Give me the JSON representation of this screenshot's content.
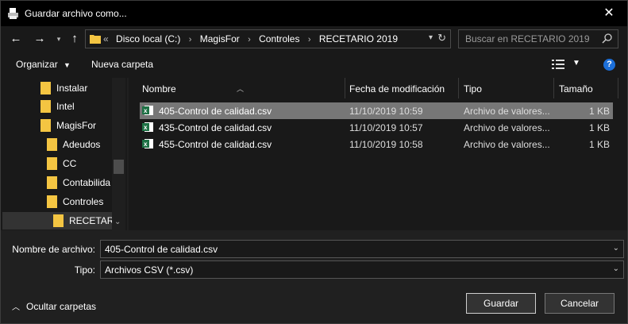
{
  "window": {
    "title": "Guardar archivo como...",
    "close_glyph": "✕"
  },
  "address_bar": {
    "more_glyph": "«",
    "crumbs": [
      "Disco local (C:)",
      "MagisFor",
      "Controles",
      "RECETARIO 2019"
    ]
  },
  "search": {
    "placeholder": "Buscar en RECETARIO 2019"
  },
  "toolbar": {
    "organize_label": "Organizar",
    "new_folder_label": "Nueva carpeta",
    "help_label": "?"
  },
  "tree": {
    "items": [
      {
        "label": "Instalar"
      },
      {
        "label": "Intel"
      },
      {
        "label": "MagisFor"
      },
      {
        "label": "Adeudos"
      },
      {
        "label": "CC"
      },
      {
        "label": "Contabilida"
      },
      {
        "label": "Controles"
      },
      {
        "label": "RECETARIO"
      }
    ]
  },
  "columns": {
    "name": "Nombre",
    "modified": "Fecha de modificación",
    "type": "Tipo",
    "size": "Tamaño"
  },
  "files": [
    {
      "name": "405-Control de calidad.csv",
      "modified": "11/10/2019 10:59",
      "type": "Archivo de valores...",
      "size": "1 KB",
      "selected": true
    },
    {
      "name": "435-Control de calidad.csv",
      "modified": "11/10/2019 10:57",
      "type": "Archivo de valores...",
      "size": "1 KB",
      "selected": false
    },
    {
      "name": "455-Control de calidad.csv",
      "modified": "11/10/2019 10:58",
      "type": "Archivo de valores...",
      "size": "1 KB",
      "selected": false
    }
  ],
  "form": {
    "filename_label": "Nombre de archivo:",
    "filename_value": "405-Control de calidad.csv",
    "type_label": "Tipo:",
    "type_value": "Archivos CSV (*.csv)"
  },
  "footer": {
    "hide_folders_label": "Ocultar carpetas",
    "save_label": "Guardar",
    "cancel_label": "Cancelar"
  },
  "colors": {
    "background": "#202020",
    "panel": "#191919",
    "selection": "#777777",
    "folder": "#f4c542",
    "excel": "#1e7145",
    "help": "#1c6fd9"
  }
}
